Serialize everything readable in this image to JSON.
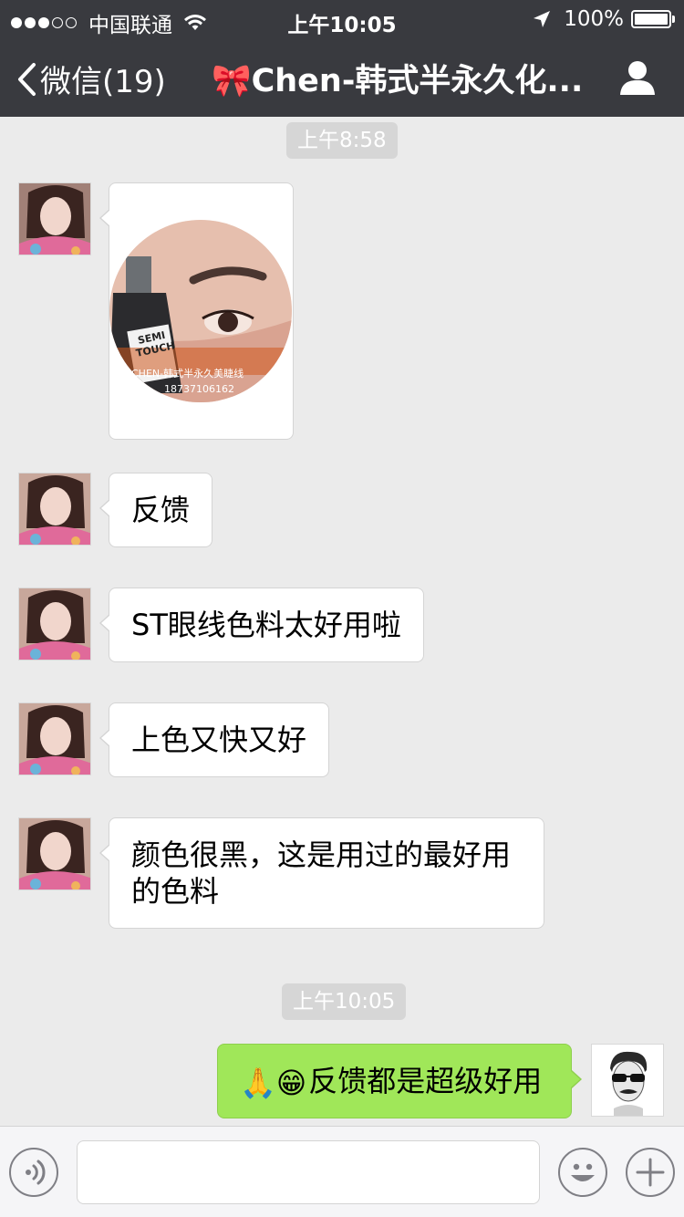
{
  "status_bar": {
    "carrier": "中国联通",
    "time": "上午10:05",
    "battery": "100%",
    "signal_bars_filled": 3,
    "signal_bars_total": 5
  },
  "nav": {
    "back_label": "微信(19)",
    "title": "🎀Chen-韩式半永久化..."
  },
  "messages": {
    "time_1": "上午8:58",
    "img_watermark_1": "CHEN-韩式半永久美睫线",
    "img_watermark_2": "18737106162",
    "img_product_1": "SEMI",
    "img_product_2": "TOUCH",
    "msg_1": "反馈",
    "msg_2": "ST眼线色料太好用啦",
    "msg_3": "上色又快又好",
    "msg_4_line1": "颜色很黑，这是用过的最好用",
    "msg_4_line2": "的色料",
    "time_2": "上午10:05",
    "my_emoji": "🙏😁",
    "my_msg": "反馈都是超级好用"
  },
  "input": {
    "placeholder": ""
  },
  "colors": {
    "header_bg": "#393a3f",
    "chat_bg": "#ebebeb",
    "bubble_me": "#a0e759",
    "bubble_other": "#ffffff"
  }
}
